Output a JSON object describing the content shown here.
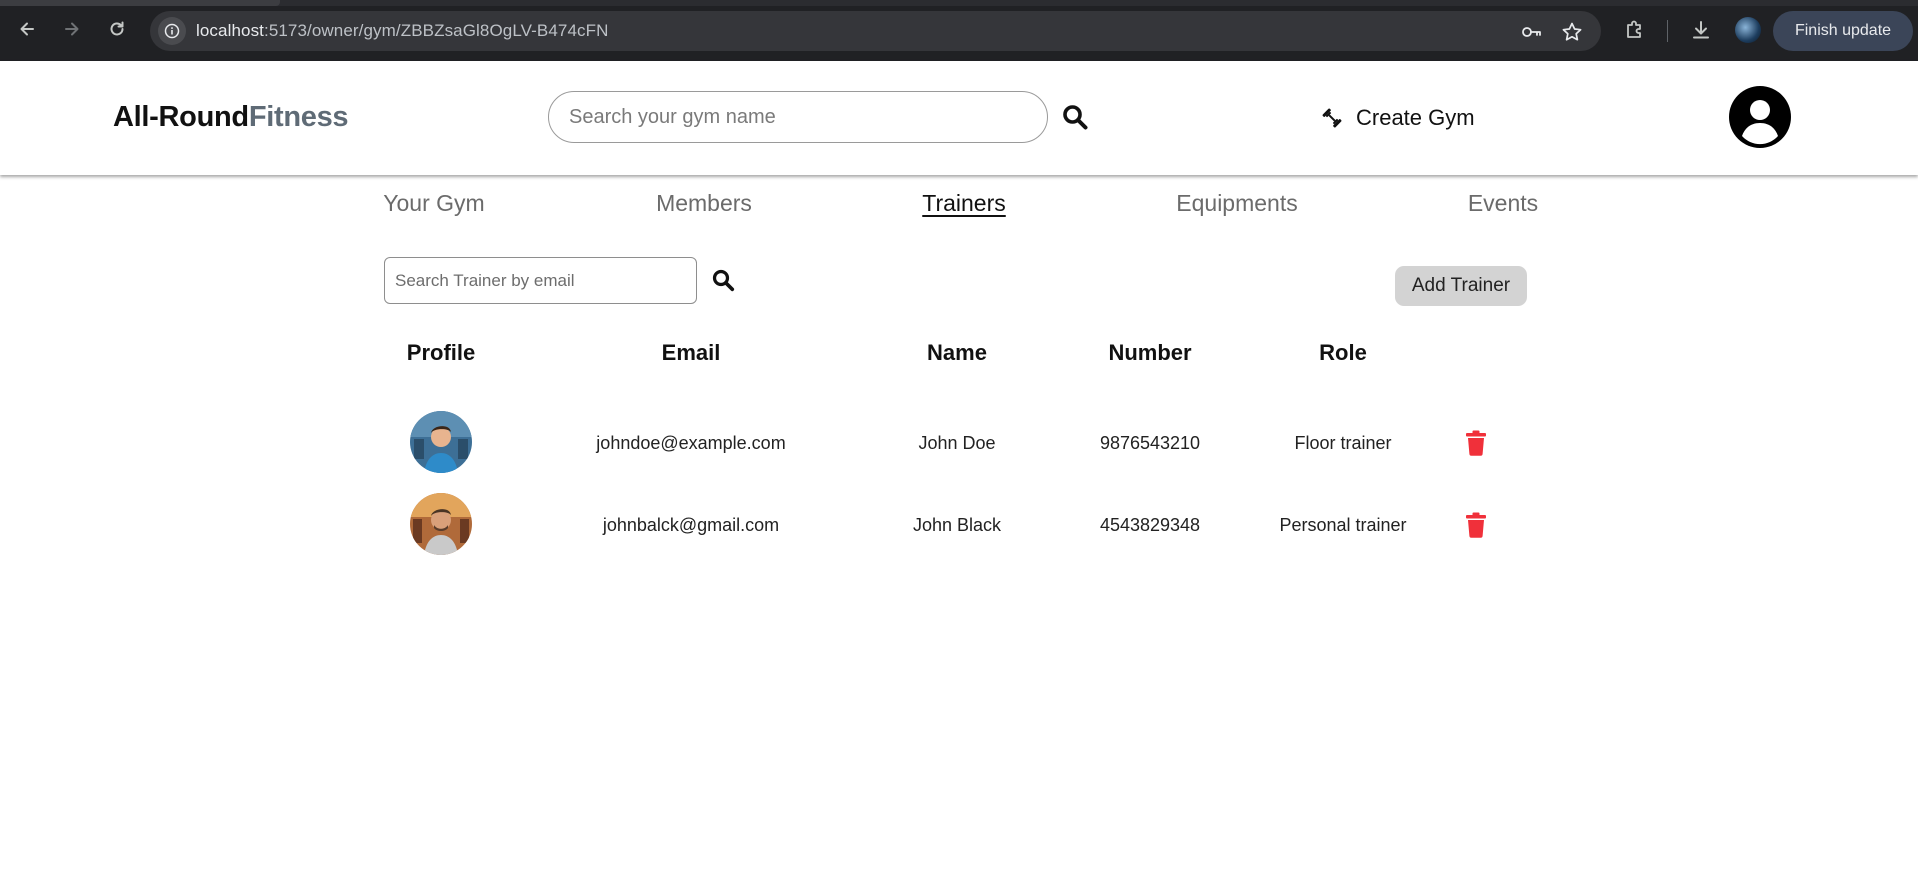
{
  "browser": {
    "url_host": "localhost",
    "url_path": ":5173/owner/gym/ZBBZsaGl8OgLV-B474cFN",
    "finish_update_label": "Finish update"
  },
  "header": {
    "logo_primary": "All-Round",
    "logo_accent": "Fitness",
    "search_placeholder": "Search your gym name",
    "create_gym_label": "Create Gym"
  },
  "tabs": [
    {
      "label": "Your Gym",
      "active": false
    },
    {
      "label": "Members",
      "active": false
    },
    {
      "label": "Trainers",
      "active": true
    },
    {
      "label": "Equipments",
      "active": false
    },
    {
      "label": "Events",
      "active": false
    }
  ],
  "trainer_search": {
    "placeholder": "Search Trainer by email"
  },
  "add_trainer_label": "Add Trainer",
  "table": {
    "columns": [
      "Profile",
      "Email",
      "Name",
      "Number",
      "Role"
    ],
    "rows": [
      {
        "email": "johndoe@example.com",
        "name": "John Doe",
        "number": "9876543210",
        "role": "Floor trainer"
      },
      {
        "email": "johnbalck@gmail.com",
        "name": "John Black",
        "number": "4543829348",
        "role": "Personal trainer"
      }
    ]
  },
  "colors": {
    "chrome_bg": "#202124",
    "logo_accent": "#5f6b76",
    "active_tab": "#111111",
    "inactive_tab": "#6b6b6b",
    "delete_icon": "#f0303a",
    "add_button_bg": "#d3d3d3"
  },
  "icons": {
    "back": "arrow-left-icon",
    "forward": "arrow-right-icon",
    "reload": "reload-icon",
    "site_info": "site-info-icon",
    "password": "key-icon",
    "bookmark": "star-icon",
    "extensions": "puzzle-icon",
    "downloads": "download-icon",
    "search": "search-icon",
    "create_gym": "dumbbell-icon",
    "profile": "user-circle-icon",
    "delete": "trash-icon"
  }
}
